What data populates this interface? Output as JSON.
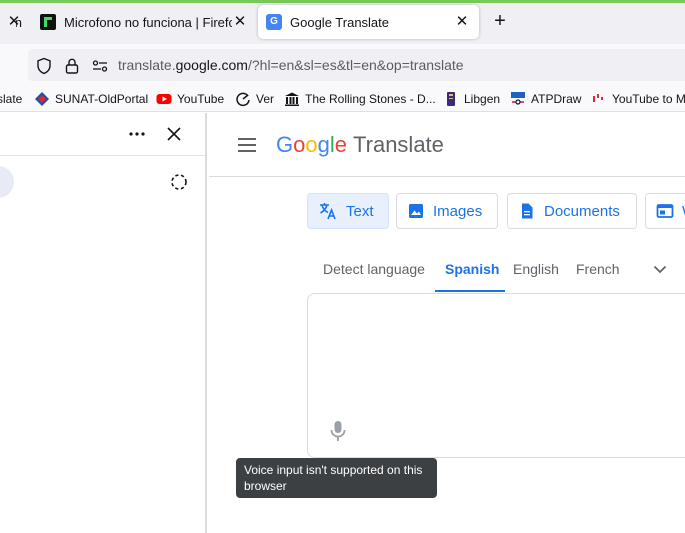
{
  "browser": {
    "tabs": [
      {
        "title": "n",
        "active": false
      },
      {
        "title": "Microfono no funciona | Firefox",
        "active": false
      },
      {
        "title": "Google Translate",
        "active": true
      }
    ],
    "new_tab_icon": "plus-icon",
    "url_prefix": "translate.",
    "url_host": "google.com",
    "url_path": "/?hl=en&sl=es&tl=en&op=translate"
  },
  "bookmarks": [
    {
      "label": "slate",
      "icon": "none"
    },
    {
      "label": "SUNAT-OldPortal",
      "icon": "sunat-icon"
    },
    {
      "label": "YouTube",
      "icon": "youtube-icon"
    },
    {
      "label": "Ver",
      "icon": "ver-icon"
    },
    {
      "label": "The Rolling Stones - D...",
      "icon": "building-icon"
    },
    {
      "label": "Libgen",
      "icon": "libgen-icon"
    },
    {
      "label": "ATPDraw",
      "icon": "atp-icon"
    },
    {
      "label": "YouTube to M",
      "icon": "youtube-to-mp3-icon"
    }
  ],
  "translate": {
    "brand_letters": [
      {
        "ch": "G",
        "color": "#4285F4"
      },
      {
        "ch": "o",
        "color": "#EA4335"
      },
      {
        "ch": "o",
        "color": "#FBBC05"
      },
      {
        "ch": "g",
        "color": "#4285F4"
      },
      {
        "ch": "l",
        "color": "#34A853"
      },
      {
        "ch": "e",
        "color": "#EA4335"
      }
    ],
    "product": "Translate",
    "modes": {
      "text": "Text",
      "images": "Images",
      "documents": "Documents",
      "websites": "W"
    },
    "languages": [
      "Detect language",
      "Spanish",
      "English",
      "French"
    ],
    "active_language": "Spanish",
    "source_text": "",
    "tooltip": "Voice input isn't supported on this browser"
  },
  "colors": {
    "accent": "#1a73e8",
    "tab_accent": "#79c85a",
    "tooltip_bg": "#3c4043"
  }
}
